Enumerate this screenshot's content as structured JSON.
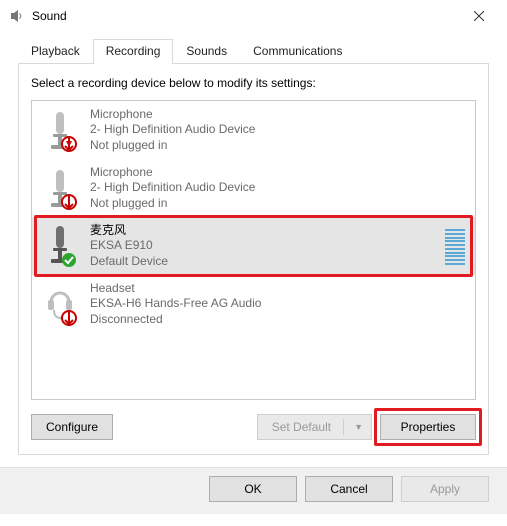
{
  "window": {
    "title": "Sound"
  },
  "tabs": {
    "items": [
      {
        "label": "Playback"
      },
      {
        "label": "Recording"
      },
      {
        "label": "Sounds"
      },
      {
        "label": "Communications"
      }
    ],
    "activeIndex": 1
  },
  "recording": {
    "instruction": "Select a recording device below to modify its settings:",
    "devices": [
      {
        "name": "Microphone",
        "line2": "2- High Definition Audio Device",
        "line3": "Not plugged in",
        "status": "unplugged",
        "selected": false
      },
      {
        "name": "Microphone",
        "line2": "2- High Definition Audio Device",
        "line3": "Not plugged in",
        "status": "unplugged",
        "selected": false
      },
      {
        "name": "麦克风",
        "line2": "EKSA E910",
        "line3": "Default Device",
        "status": "default",
        "selected": true
      },
      {
        "name": "Headset",
        "line2": "EKSA-H6 Hands-Free AG Audio",
        "line3": "Disconnected",
        "status": "unplugged",
        "selected": false
      }
    ],
    "buttons": {
      "configure": "Configure",
      "set_default": "Set Default",
      "properties": "Properties"
    }
  },
  "dialog_buttons": {
    "ok": "OK",
    "cancel": "Cancel",
    "apply": "Apply"
  },
  "highlights": {
    "selected_device": true,
    "properties_button": true
  }
}
